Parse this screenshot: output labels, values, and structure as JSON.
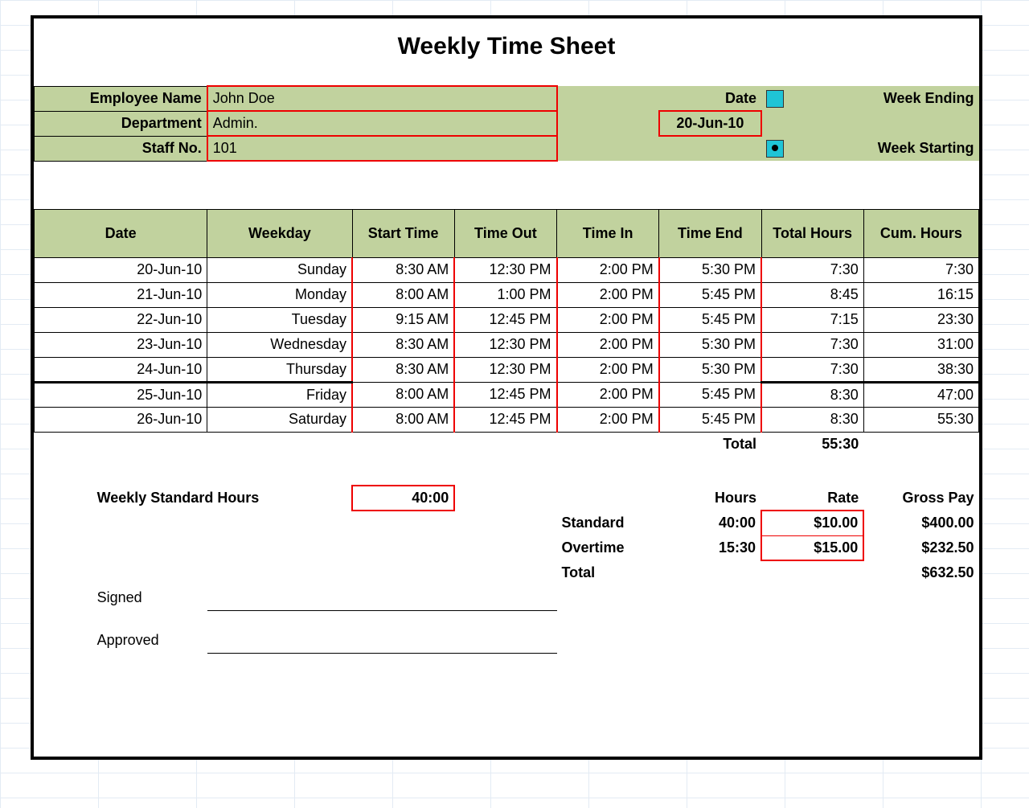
{
  "title": "Weekly Time Sheet",
  "header": {
    "empLabel": "Employee Name",
    "empName": "John Doe",
    "deptLabel": "Department",
    "dept": "Admin.",
    "staffLabel": "Staff No.",
    "staff": "101",
    "dateLabel": "Date",
    "date": "20-Jun-10",
    "wkEnd": "Week Ending",
    "wkStart": "Week Starting"
  },
  "cols": {
    "date": "Date",
    "wd": "Weekday",
    "start": "Start Time",
    "tout": "Time Out",
    "tin": "Time In",
    "tend": "Time End",
    "th": "Total Hours",
    "cum": "Cum. Hours"
  },
  "rows": [
    {
      "date": "20-Jun-10",
      "wd": "Sunday",
      "start": "8:30 AM",
      "tout": "12:30 PM",
      "tin": "2:00 PM",
      "tend": "5:30 PM",
      "th": "7:30",
      "cum": "7:30"
    },
    {
      "date": "21-Jun-10",
      "wd": "Monday",
      "start": "8:00 AM",
      "tout": "1:00 PM",
      "tin": "2:00 PM",
      "tend": "5:45 PM",
      "th": "8:45",
      "cum": "16:15"
    },
    {
      "date": "22-Jun-10",
      "wd": "Tuesday",
      "start": "9:15 AM",
      "tout": "12:45 PM",
      "tin": "2:00 PM",
      "tend": "5:45 PM",
      "th": "7:15",
      "cum": "23:30"
    },
    {
      "date": "23-Jun-10",
      "wd": "Wednesday",
      "start": "8:30 AM",
      "tout": "12:30 PM",
      "tin": "2:00 PM",
      "tend": "5:30 PM",
      "th": "7:30",
      "cum": "31:00"
    },
    {
      "date": "24-Jun-10",
      "wd": "Thursday",
      "start": "8:30 AM",
      "tout": "12:30 PM",
      "tin": "2:00 PM",
      "tend": "5:30 PM",
      "th": "7:30",
      "cum": "38:30"
    },
    {
      "date": "25-Jun-10",
      "wd": "Friday",
      "start": "8:00 AM",
      "tout": "12:45 PM",
      "tin": "2:00 PM",
      "tend": "5:45 PM",
      "th": "8:30",
      "cum": "47:00"
    },
    {
      "date": "26-Jun-10",
      "wd": "Saturday",
      "start": "8:00 AM",
      "tout": "12:45 PM",
      "tin": "2:00 PM",
      "tend": "5:45 PM",
      "th": "8:30",
      "cum": "55:30"
    }
  ],
  "totals": {
    "label": "Total",
    "hours": "55:30"
  },
  "pay": {
    "wshLabel": "Weekly Standard Hours",
    "wsh": "40:00",
    "hoursLabel": "Hours",
    "rateLabel": "Rate",
    "gpLabel": "Gross Pay",
    "stdLabel": "Standard",
    "stdHours": "40:00",
    "stdRate": "$10.00",
    "stdGross": "$400.00",
    "otLabel": "Overtime",
    "otHours": "15:30",
    "otRate": "$15.00",
    "otGross": "$232.50",
    "totalLabel": "Total",
    "totalGross": "$632.50"
  },
  "sign": {
    "signed": "Signed",
    "approved": "Approved"
  }
}
